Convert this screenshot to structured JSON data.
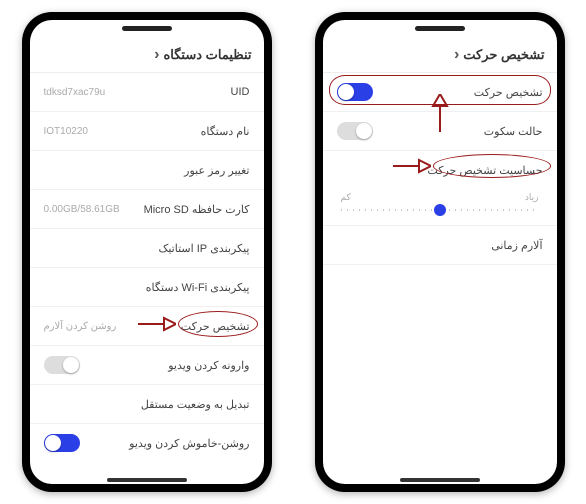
{
  "left": {
    "title": "تنظیمات دستگاه",
    "rows": {
      "uid_label": "UID",
      "uid_value": "tdksd7xac79u",
      "name_label": "نام دستگاه",
      "name_value": "IOT10220",
      "pass_label": "تغییر رمز عبور",
      "sd_label": "کارت حافظه Micro SD",
      "sd_value": "0.00GB/58.61GB",
      "ip_label": "پیکربندی IP استاتیک",
      "wifi_label": "پیکربندی Wi-Fi دستگاه",
      "motion_label": "تشخیص حرکت",
      "motion_value": "روشن کردن آلارم",
      "flip_label": "وارونه کردن ویدیو",
      "standalone_label": "تبدیل به وضعیت مستقل",
      "power_label": "روشن-خاموش کردن ویدیو"
    }
  },
  "right": {
    "title": "تشخیص حرکت",
    "rows": {
      "motion_label": "تشخیص حرکت",
      "silent_label": "حالت سکوت",
      "sensitivity_label": "حساسیت تشخیص حرکت",
      "slider_low": "کم",
      "slider_high": "زیاد",
      "time_alarm_label": "آلارم زمانی"
    }
  }
}
